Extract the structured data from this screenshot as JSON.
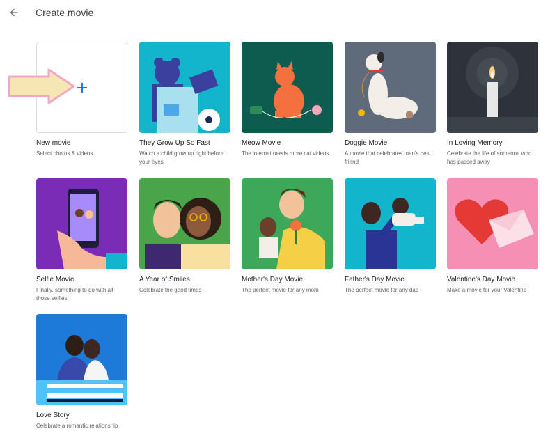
{
  "header": {
    "title": "Create movie",
    "back_icon": "arrow-back-icon"
  },
  "colors": {
    "accent": "#1a73e8",
    "annotation_arrow_fill": "#f6e6b4",
    "annotation_arrow_stroke": "#f0a8c8"
  },
  "cards": [
    {
      "id": "new-movie",
      "title": "New movie",
      "desc": "Select photos & videos",
      "icon": "plus-icon",
      "bg": "#ffffff"
    },
    {
      "id": "grow-up",
      "title": "They Grow Up So Fast",
      "desc": "Watch a child grow up right before your eyes",
      "bg": "#12b5cb"
    },
    {
      "id": "meow",
      "title": "Meow Movie",
      "desc": "The internet needs more cat videos",
      "bg": "#0d5c4f"
    },
    {
      "id": "doggie",
      "title": "Doggie Movie",
      "desc": "A movie that celebrates man's best friend",
      "bg": "#5f6b7a"
    },
    {
      "id": "memory",
      "title": "In Loving Memory",
      "desc": "Celebrate the life of someone who has passed away",
      "bg": "#2d3338"
    },
    {
      "id": "selfie",
      "title": "Selfie Movie",
      "desc": "Finally, something to do with all those selfies!",
      "bg": "#7b2cb7"
    },
    {
      "id": "smiles",
      "title": "A Year of Smiles",
      "desc": "Celebrate the good times",
      "bg": "#4aa44a"
    },
    {
      "id": "mothers",
      "title": "Mother's Day Movie",
      "desc": "The perfect movie for any mom",
      "bg": "#3da85a"
    },
    {
      "id": "fathers",
      "title": "Father's Day Movie",
      "desc": "The perfect movie for any dad",
      "bg": "#12b5cb"
    },
    {
      "id": "valentine",
      "title": "Valentine's Day Movie",
      "desc": "Make a movie for your Valentine",
      "bg": "#f58fb3"
    },
    {
      "id": "love",
      "title": "Love Story",
      "desc": "Celebrate a romantic relationship",
      "bg": "#1e7ad8"
    }
  ]
}
